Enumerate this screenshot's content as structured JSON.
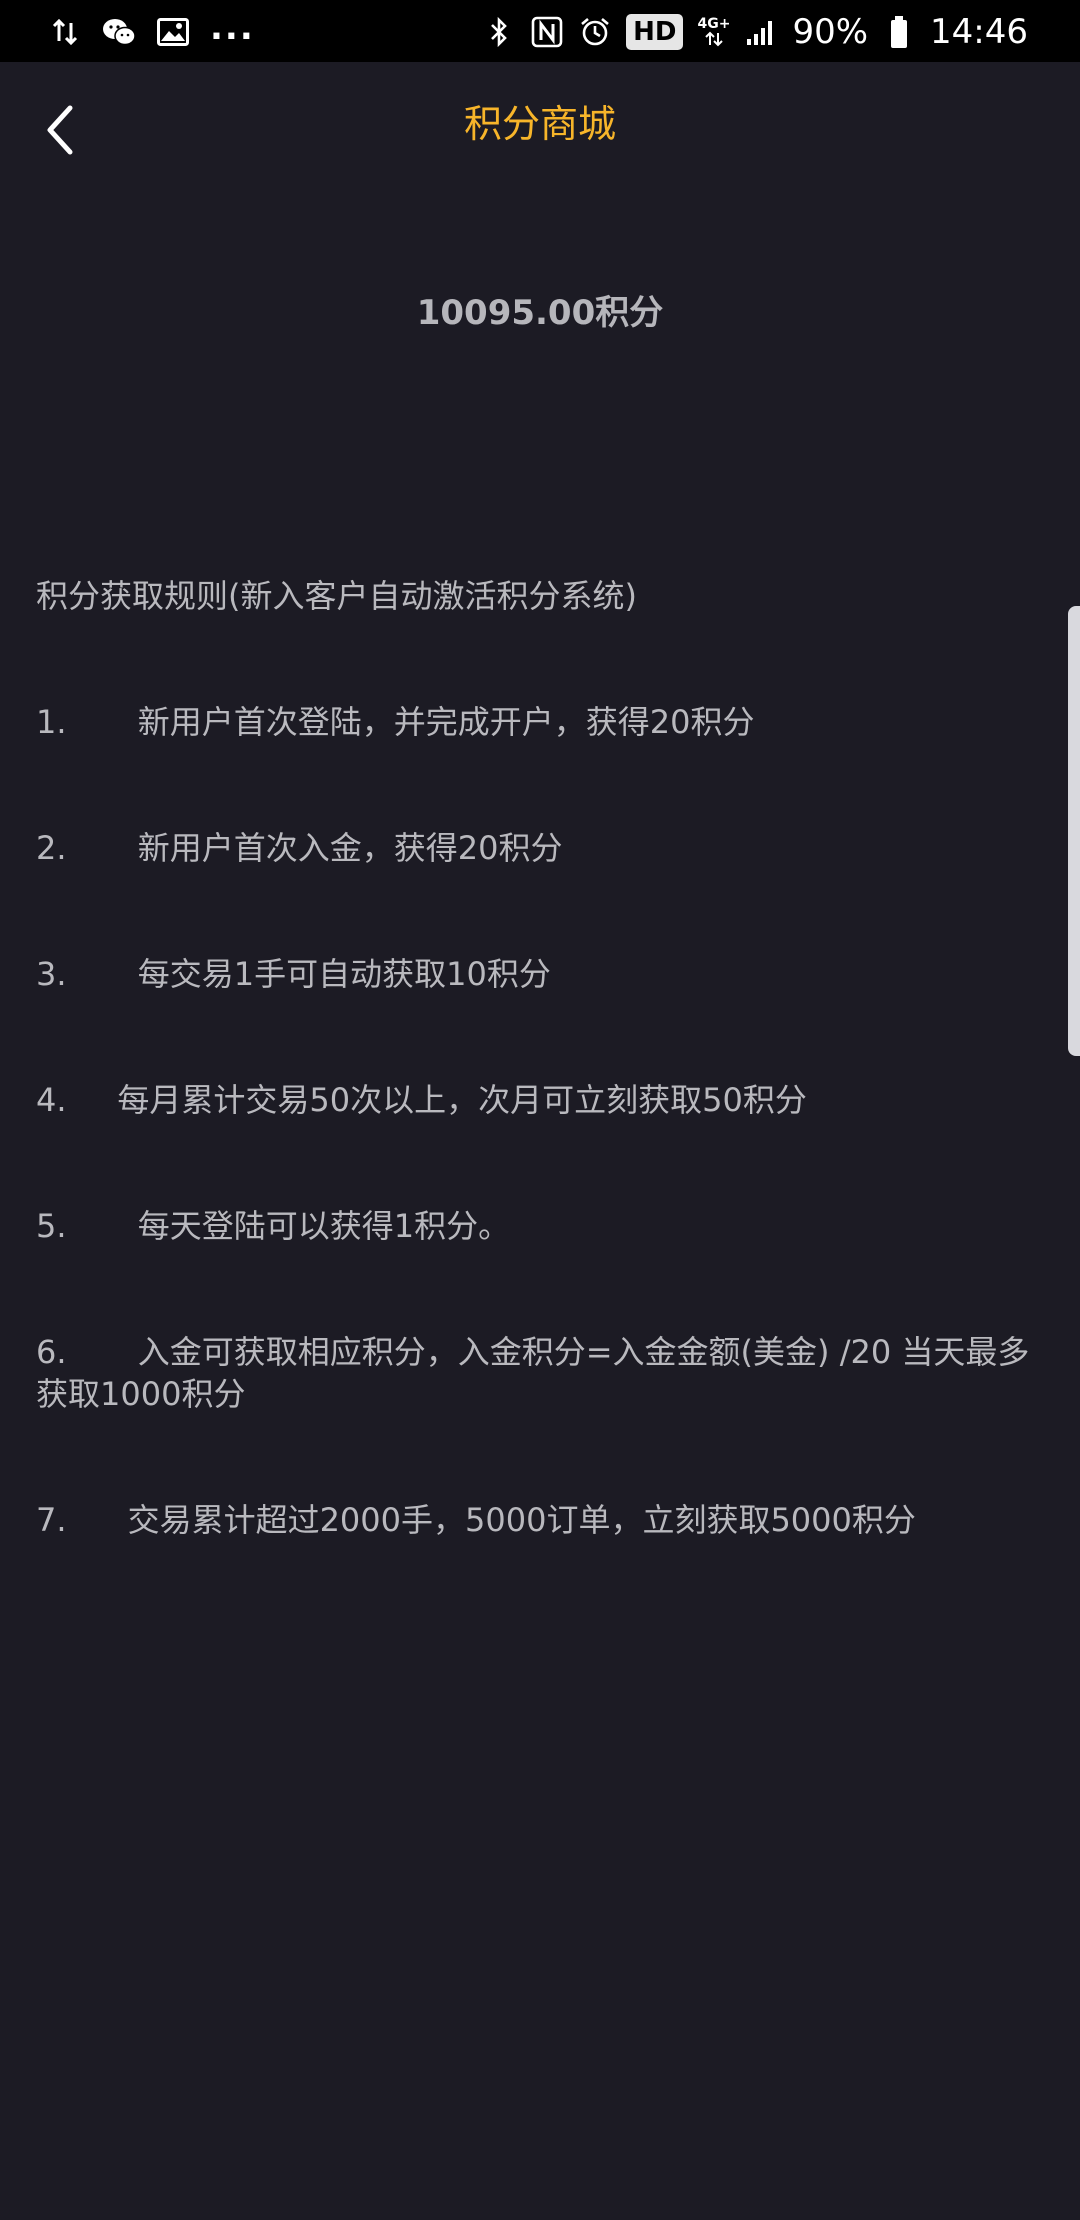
{
  "status_bar": {
    "overflow_indicator": "...",
    "hd_label": "HD",
    "network_label": "4G+",
    "battery_text": "90%",
    "time": "14:46",
    "left_icons": [
      "data-transfer-icon",
      "wechat-icon",
      "image-icon"
    ],
    "right_icons": [
      "bluetooth-icon",
      "nfc-icon",
      "alarm-icon",
      "signal-icon",
      "battery-icon"
    ]
  },
  "header": {
    "title": "积分商城",
    "title_color": "#f7b52a",
    "back_icon": "chevron-left-icon"
  },
  "points": {
    "value_text": "10095.00积分"
  },
  "rules": {
    "heading": "积分获取规则(新入客户自动激活积分系统)",
    "items": [
      "1.       新用户首次登陆，并完成开户，获得20积分",
      "2.       新用户首次入金，获得20积分",
      "3.       每交易1手可自动获取10积分",
      "4.     每月累计交易50次以上，次月可立刻获取50积分",
      "5.       每天登陆可以获得1积分。",
      "6.       入金可获取相应积分，入金积分=入金金额(美金) /20 当天最多获取1000积分",
      "7.      交易累计超过2000手，5000订单，立刻获取5000积分"
    ]
  },
  "colors": {
    "background": "#1c1b24",
    "status_bar": "#000000",
    "text": "#b9b9be"
  }
}
